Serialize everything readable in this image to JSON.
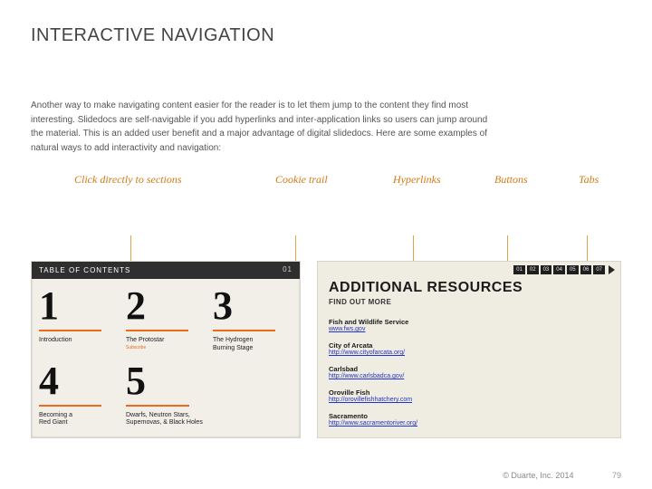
{
  "title": "INTERACTIVE NAVIGATION",
  "body_text": "Another way to make navigating content easier for the reader is to let them jump to the content they find most interesting. Slidedocs are self-navigable if you add hyperlinks and inter-application links so users can jump around the material. This is an added user benefit and a major advantage of digital slidedocs. Here are some examples of natural ways to add interactivity and navigation:",
  "labels": {
    "click_sections": "Click directly to sections",
    "cookie_trail": "Cookie trail",
    "hyperlinks": "Hyperlinks",
    "buttons": "Buttons",
    "tabs": "Tabs"
  },
  "toc": {
    "header": "TABLE OF CONTENTS",
    "page_indicator": "01",
    "cells": [
      {
        "num": "1",
        "caption": "Introduction",
        "subscribe": ""
      },
      {
        "num": "2",
        "caption": "The Protostar",
        "subscribe": "Subscribe"
      },
      {
        "num": "3",
        "caption": "The Hydrogen\nBurning Stage",
        "subscribe": ""
      },
      {
        "num": "4",
        "caption": "Becoming a\nRed Giant",
        "subscribe": ""
      },
      {
        "num": "5",
        "caption": "Dwarfs, Neutron Stars,\nSupernovas, & Black Holes",
        "subscribe": ""
      }
    ]
  },
  "resources": {
    "tabs": [
      "01",
      "02",
      "03",
      "04",
      "05",
      "06",
      "07"
    ],
    "heading": "ADDITIONAL RESOURCES",
    "subheading": "FIND OUT MORE",
    "links": [
      {
        "title": "Fish and Wildlife Service",
        "url": "www.fws.gov"
      },
      {
        "title": "City of Arcata",
        "url": "http://www.cityofarcata.org/"
      },
      {
        "title": "Carlsbad",
        "url": "http://www.carlsbadca.gov/"
      },
      {
        "title": "Oroville Fish",
        "url": "http://orovillefishhatchery.com"
      },
      {
        "title": "Sacramento",
        "url": "http://www.sacramentoriver.org/"
      }
    ]
  },
  "footer": {
    "copyright": "© Duarte, Inc. 2014",
    "page": "79"
  }
}
